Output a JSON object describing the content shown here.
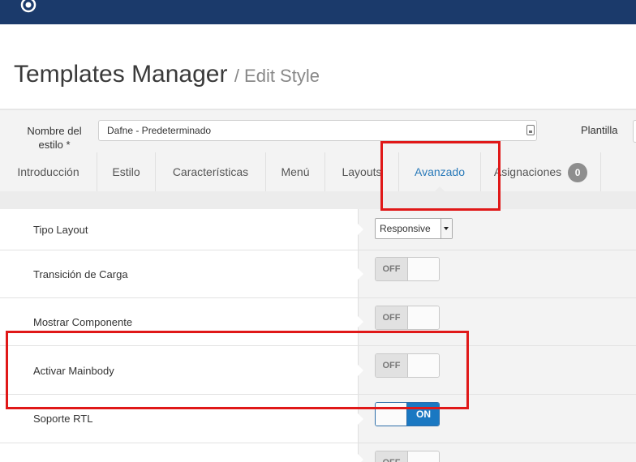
{
  "header": {
    "title": "Templates Manager",
    "subtitle": "/ Edit Style"
  },
  "style_name": {
    "label": "Nombre del estilo *",
    "value": "Dafne - Predeterminado"
  },
  "template": {
    "label": "Plantilla"
  },
  "tabs": [
    {
      "label": "Introducción",
      "active": false
    },
    {
      "label": "Estilo",
      "active": false
    },
    {
      "label": "Características",
      "active": false
    },
    {
      "label": "Menú",
      "active": false
    },
    {
      "label": "Layouts",
      "active": false
    },
    {
      "label": "Avanzado",
      "active": true
    },
    {
      "label": "Asignaciones",
      "active": false,
      "badge": "0"
    }
  ],
  "options": [
    {
      "label": "Tipo Layout",
      "control": "select",
      "value": "Responsive"
    },
    {
      "label": "Transición de Carga",
      "control": "toggle",
      "state": "OFF"
    },
    {
      "label": "Mostrar Componente",
      "control": "toggle",
      "state": "OFF"
    },
    {
      "label": "Activar Mainbody",
      "control": "toggle",
      "state": "OFF"
    },
    {
      "label": "Soporte RTL",
      "control": "toggle",
      "state": "ON"
    },
    {
      "label": "",
      "control": "toggle",
      "state": "OFF"
    }
  ],
  "colors": {
    "topbar": "#1b3a6b",
    "accent": "#2a7ab9",
    "toggle_on": "#1a78c2",
    "highlight": "#e01818"
  }
}
